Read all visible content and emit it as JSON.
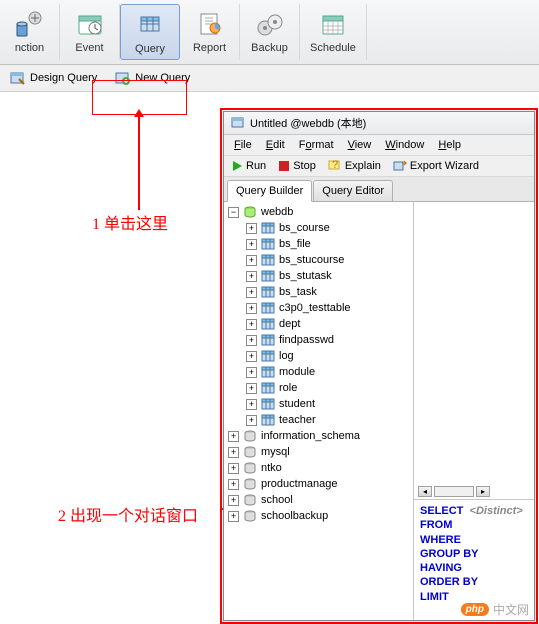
{
  "toolbar": {
    "items": [
      {
        "label": "nction",
        "active": false,
        "icon": "function-icon"
      },
      {
        "label": "Event",
        "active": false,
        "icon": "event-icon"
      },
      {
        "label": "Query",
        "active": true,
        "icon": "query-icon"
      },
      {
        "label": "Report",
        "active": false,
        "icon": "report-icon"
      },
      {
        "label": "Backup",
        "active": false,
        "icon": "backup-icon"
      },
      {
        "label": "Schedule",
        "active": false,
        "icon": "schedule-icon"
      }
    ]
  },
  "subtoolbar": {
    "design_query": "Design Query",
    "new_query": "New Query"
  },
  "annotations": {
    "ann1": "1 单击这里",
    "ann2": "2 出现一个对话窗口"
  },
  "dialog": {
    "title": "Untitled @webdb (本地)",
    "menu": [
      "File",
      "Edit",
      "Format",
      "View",
      "Window",
      "Help"
    ],
    "toolbar": {
      "run": "Run",
      "stop": "Stop",
      "explain": "Explain",
      "export": "Export Wizard"
    },
    "tabs": [
      "Query Builder",
      "Query Editor"
    ],
    "active_tab": 0,
    "tree": {
      "root": "webdb",
      "tables": [
        "bs_course",
        "bs_file",
        "bs_stucourse",
        "bs_stutask",
        "bs_task",
        "c3p0_testtable",
        "dept",
        "findpasswd",
        "log",
        "module",
        "role",
        "student",
        "teacher"
      ],
      "other_dbs": [
        "information_schema",
        "mysql",
        "ntko",
        "productmanage",
        "school",
        "schoolbackup"
      ]
    },
    "sql": {
      "keywords": [
        "SELECT",
        "FROM",
        "WHERE",
        "GROUP BY",
        "HAVING",
        "ORDER BY",
        "LIMIT"
      ],
      "hint": "<Distinct>"
    }
  },
  "watermark": {
    "badge": "php",
    "text": "中文网"
  },
  "colors": {
    "annotation": "#ff0000",
    "sql_keyword": "#0000cc",
    "watermark_badge": "#f77a1b"
  }
}
